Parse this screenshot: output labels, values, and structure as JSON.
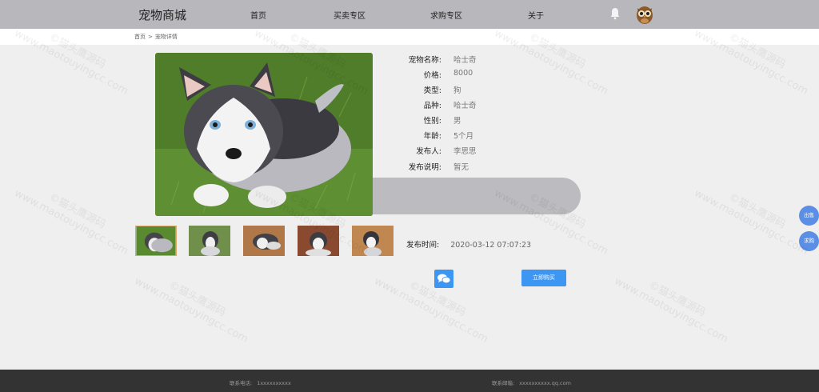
{
  "header": {
    "brand": "宠物商城",
    "nav": [
      "首页",
      "买卖专区",
      "求购专区",
      "关于"
    ],
    "icons": {
      "bell": "bell-icon",
      "avatar": "owl-avatar"
    }
  },
  "breadcrumb": {
    "home": "首页",
    "separator": ">",
    "current": "宠物详情"
  },
  "pet": {
    "fields": [
      {
        "label": "宠物名称:",
        "value": "哈士奇"
      },
      {
        "label": "价格:",
        "value": "8000"
      },
      {
        "label": "类型:",
        "value": "狗"
      },
      {
        "label": "品种:",
        "value": "哈士奇"
      },
      {
        "label": "性别:",
        "value": "男"
      },
      {
        "label": "年龄:",
        "value": "5个月"
      },
      {
        "label": "发布人:",
        "value": "李思思"
      },
      {
        "label": "发布说明:",
        "value": "暂无"
      }
    ],
    "publish_time_label": "发布时间:",
    "publish_time": "2020-03-12 07:07:23",
    "thumbnail_count": 5
  },
  "actions": {
    "chat_icon": "chat-bubbles-icon",
    "buy_label": "立即购买"
  },
  "side": {
    "sell": "出售",
    "want": "求购"
  },
  "footer": {
    "phone_label": "联系电话:",
    "phone": "1xxxxxxxxxx",
    "email_label": "联系邮箱:",
    "email": "xxxxxxxxxx.qq.com"
  },
  "watermark": {
    "cn": "©猫头鹰源码",
    "en": "www.maotouyingcc.com"
  },
  "colors": {
    "accent": "#3d96f2",
    "header": "#b8b8bc",
    "footer": "#333333",
    "side": "#5b8fe6"
  }
}
